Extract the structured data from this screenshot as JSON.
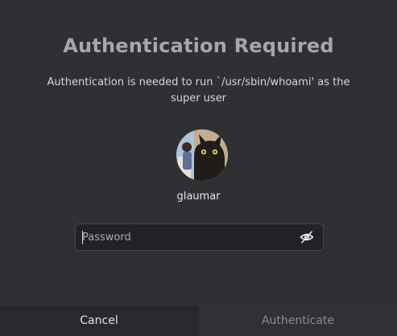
{
  "dialog": {
    "title": "Authentication Required",
    "message": "Authentication is needed to run `/usr/sbin/whoami' as the super user",
    "username": "glaumar",
    "password": {
      "placeholder": "Password",
      "value": ""
    },
    "visibility_icon": "eye-off-icon",
    "buttons": {
      "cancel_label": "Cancel",
      "authenticate_label": "Authenticate"
    }
  }
}
